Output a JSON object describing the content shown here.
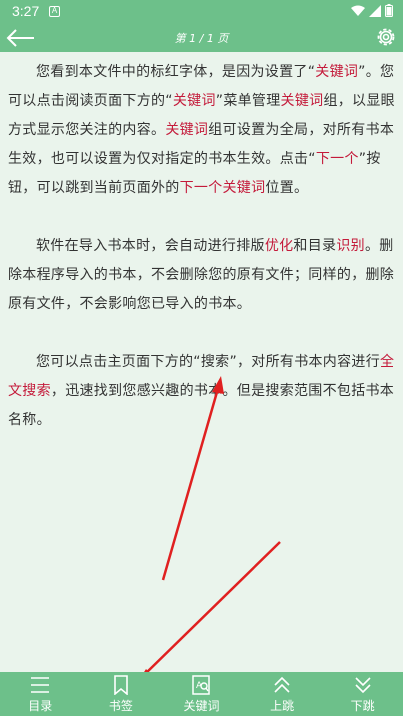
{
  "status": {
    "time": "3:27",
    "notif_glyph": "A"
  },
  "header": {
    "page_indicator": "第 1 / 1 页",
    "back_icon": "arrow-left-icon",
    "settings_icon": "gear-icon"
  },
  "content": {
    "p1": [
      {
        "t": "您看到本文件中的标红字体，是因为设置了“"
      },
      {
        "t": "关键词",
        "kw": true
      },
      {
        "t": "”。您可以点击阅读页面下方的“"
      },
      {
        "t": "关键词",
        "kw": true
      },
      {
        "t": "”菜单管理"
      },
      {
        "t": "关键词",
        "kw": true
      },
      {
        "t": "组，以显眼方式显示您关注的内容。"
      },
      {
        "t": "关键词",
        "kw": true
      },
      {
        "t": "组可设置为全局，对所有书本生效，也可以设置为仅对指定的书本生效。点击“"
      },
      {
        "t": "下一个",
        "kw": true
      },
      {
        "t": "”按钮，可以跳到当前页面外的"
      },
      {
        "t": "下一个关键词",
        "kw": true
      },
      {
        "t": "位置。"
      }
    ],
    "p2": [
      {
        "t": "软件在导入书本时，会自动进行排版"
      },
      {
        "t": "优化",
        "kw": true
      },
      {
        "t": "和目录"
      },
      {
        "t": "识别",
        "kw": true
      },
      {
        "t": "。删除本程序导入的书本，不会删除您的原有文件；同样的，删除原有文件，不会影响您已导入的书本。"
      }
    ],
    "p3": [
      {
        "t": "您可以点击主页面下方的“搜索”，对所有书本内容进行"
      },
      {
        "t": "全文搜索",
        "kw": true
      },
      {
        "t": "，迅速找到您感兴趣的书本。但是搜索范围不包括书本名称。"
      }
    ]
  },
  "bottom_nav": {
    "toc": "目录",
    "bookmark": "书签",
    "keyword": "关键词",
    "jump_up": "上跳",
    "jump_down": "下跳"
  },
  "colors": {
    "bar": "#6dc08a",
    "background": "#eaf4ec",
    "keyword": "#c41a3a",
    "annotation_arrow": "#e02020"
  }
}
